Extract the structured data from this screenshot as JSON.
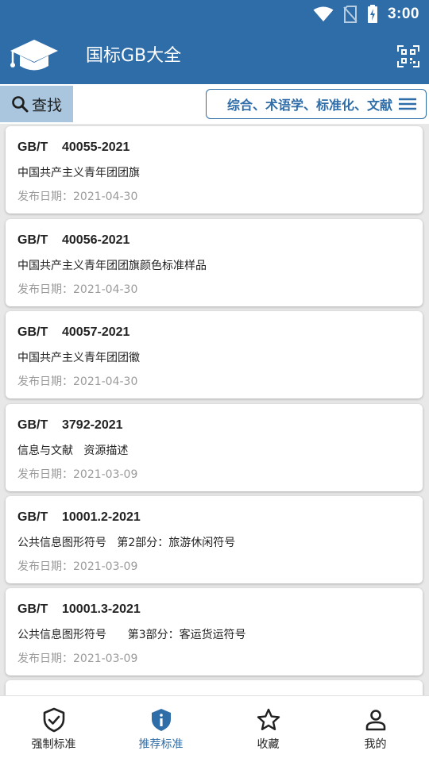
{
  "status_bar": {
    "time": "3:00"
  },
  "app_bar": {
    "title": "国标GB大全"
  },
  "toolbar": {
    "search_label": "查找",
    "category_label": "综合、术语学、标准化、文献"
  },
  "standards": [
    {
      "code": "GB/T    40055-2021",
      "name": "中国共产主义青年团团旗",
      "date": "发布日期：2021-04-30"
    },
    {
      "code": "GB/T    40056-2021",
      "name": "中国共产主义青年团团旗颜色标准样品",
      "date": "发布日期：2021-04-30"
    },
    {
      "code": "GB/T    40057-2021",
      "name": "中国共产主义青年团团徽",
      "date": "发布日期：2021-04-30"
    },
    {
      "code": "GB/T    3792-2021",
      "name": "信息与文献   资源描述",
      "date": "发布日期：2021-03-09"
    },
    {
      "code": "GB/T    10001.2-2021",
      "name": "公共信息图形符号   第2部分：旅游休闲符号",
      "date": "发布日期：2021-03-09"
    },
    {
      "code": "GB/T    10001.3-2021",
      "name": "公共信息图形符号      第3部分：客运货运符号",
      "date": "发布日期：2021-03-09"
    }
  ],
  "bottom_nav": [
    {
      "label": "强制标准",
      "icon": "shield-check-icon"
    },
    {
      "label": "推荐标准",
      "icon": "shield-info-icon",
      "active": true
    },
    {
      "label": "收藏",
      "icon": "star-icon"
    },
    {
      "label": "我的",
      "icon": "person-icon"
    }
  ],
  "colors": {
    "primary": "#2f6da8",
    "search_bg": "#a9c6de",
    "date_text": "#9a9a9a"
  }
}
